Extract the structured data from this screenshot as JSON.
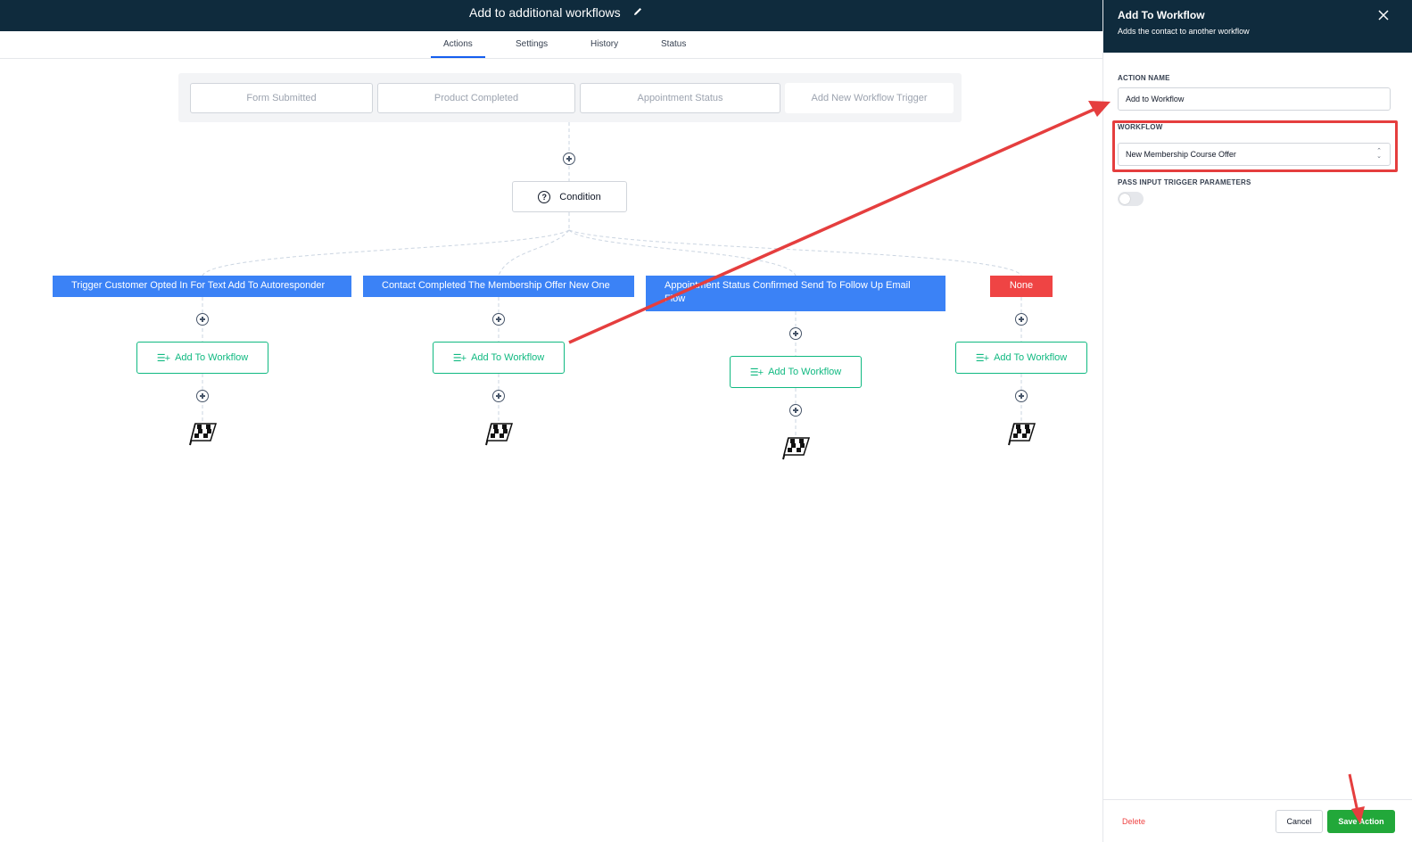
{
  "header": {
    "title": "Add to additional workflows"
  },
  "tabs": [
    {
      "label": "Actions",
      "active": true
    },
    {
      "label": "Settings",
      "active": false
    },
    {
      "label": "History",
      "active": false
    },
    {
      "label": "Status",
      "active": false
    }
  ],
  "triggers": [
    "Form Submitted",
    "Product Completed",
    "Appointment Status",
    "Add New Workflow Trigger"
  ],
  "condition": {
    "label": "Condition",
    "icon": "question-circle-icon"
  },
  "branches": [
    {
      "label": "Trigger Customer Opted In For Text Add To Autoresponder",
      "action": "Add To Workflow"
    },
    {
      "label": "Contact Completed The Membership Offer New One",
      "action": "Add To Workflow"
    },
    {
      "label": "Appointment Status Confirmed Send To Follow Up Email Flow",
      "action": "Add To Workflow"
    },
    {
      "label": "None",
      "action": "Add To Workflow"
    }
  ],
  "panel": {
    "title": "Add To Workflow",
    "subtitle": "Adds the contact to another workflow",
    "action_name_label": "ACTION NAME",
    "action_name_value": "Add to Workflow",
    "workflow_label": "WORKFLOW",
    "workflow_value": "New Membership Course Offer",
    "pass_params_label": "PASS INPUT TRIGGER PARAMETERS",
    "pass_params_enabled": false,
    "delete_label": "Delete",
    "cancel_label": "Cancel",
    "save_label": "Save Action"
  },
  "colors": {
    "header_bg": "#0f2b3d",
    "branch_blue": "#3b82f6",
    "branch_none": "#ef4444",
    "action_green": "#10b981",
    "save_green": "#22a83a",
    "annotation_red": "#e53e3e"
  }
}
